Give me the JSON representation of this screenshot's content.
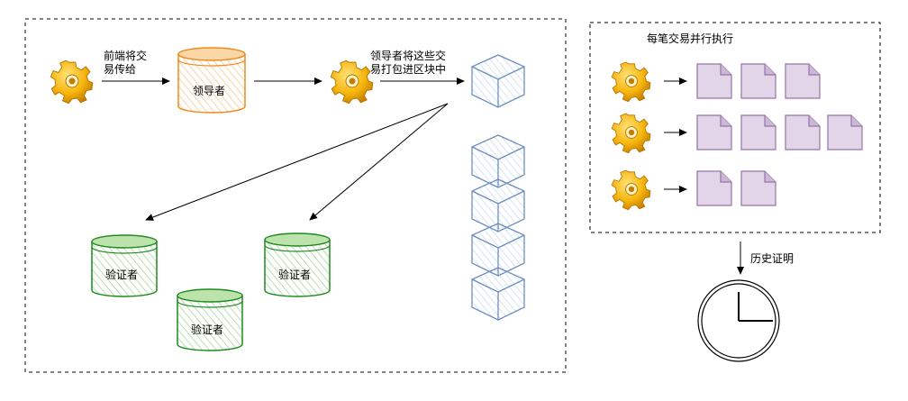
{
  "labels": {
    "frontend_to_leader": [
      "前端将交",
      "易传给"
    ],
    "leader_pack": [
      "领导者将这些交",
      "易打包进区块中"
    ],
    "parallel": "每笔交易并行执行",
    "history_proof": "历史证明"
  },
  "nodes": {
    "leader": "领导者",
    "validator": "验证者"
  },
  "colors": {
    "leader_stroke": "#f08a1c",
    "leader_fill": "#fbd7a8",
    "validator_stroke": "#1f8a1f",
    "validator_fill": "#bde3ad",
    "block_stroke": "#6c8ebf",
    "block_fill": "#dae8fc",
    "doc_stroke": "#9673a6",
    "doc_fill": "#e1d5e7",
    "gear": "#f2b200"
  },
  "icons": [
    "gear-icon",
    "document-icon",
    "block-cube-icon",
    "clock-icon",
    "database-icon"
  ]
}
